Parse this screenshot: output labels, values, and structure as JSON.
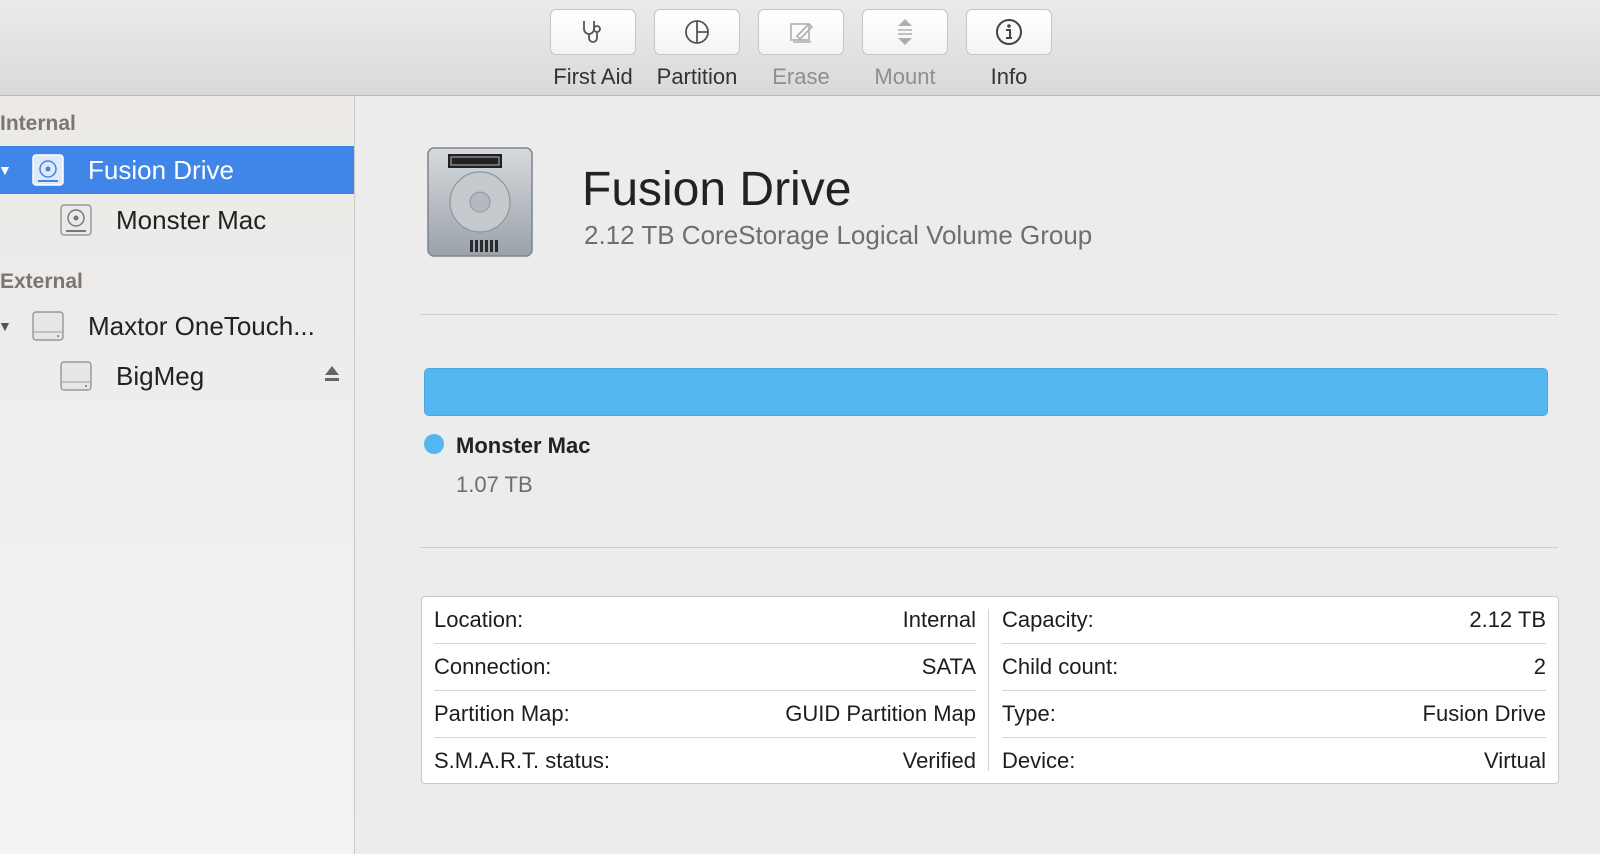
{
  "toolbar": {
    "buttons": [
      {
        "label": "First Aid",
        "icon": "stethoscope-icon",
        "enabled": true
      },
      {
        "label": "Partition",
        "icon": "pie-chart-icon",
        "enabled": true
      },
      {
        "label": "Erase",
        "icon": "erase-pencil-icon",
        "enabled": false
      },
      {
        "label": "Mount",
        "icon": "mount-arrows-icon",
        "enabled": false
      },
      {
        "label": "Info",
        "icon": "info-icon",
        "enabled": true
      }
    ]
  },
  "sidebar": {
    "internal_label": "Internal",
    "external_label": "External",
    "items": [
      {
        "label": "Fusion Drive",
        "selected": true,
        "expanded": true
      },
      {
        "label": "Monster Mac"
      },
      {
        "label": "Maxtor OneTouch...",
        "expanded": true
      },
      {
        "label": "BigMeg",
        "ejectable": true
      }
    ],
    "selection_color": "#3f86e8"
  },
  "main": {
    "title": "Fusion Drive",
    "subtitle": "2.12 TB CoreStorage Logical Volume Group",
    "usage_bar_color": "#55b7f2",
    "volume": {
      "name": "Monster Mac",
      "size": "1.07 TB"
    },
    "info_left": [
      {
        "label": "Location:",
        "value": "Internal"
      },
      {
        "label": "Connection:",
        "value": "SATA"
      },
      {
        "label": "Partition Map:",
        "value": "GUID Partition Map"
      },
      {
        "label": "S.M.A.R.T. status:",
        "value": "Verified"
      }
    ],
    "info_right": [
      {
        "label": "Capacity:",
        "value": "2.12 TB"
      },
      {
        "label": "Child count:",
        "value": "2"
      },
      {
        "label": "Type:",
        "value": "Fusion Drive"
      },
      {
        "label": "Device:",
        "value": "Virtual"
      }
    ]
  }
}
